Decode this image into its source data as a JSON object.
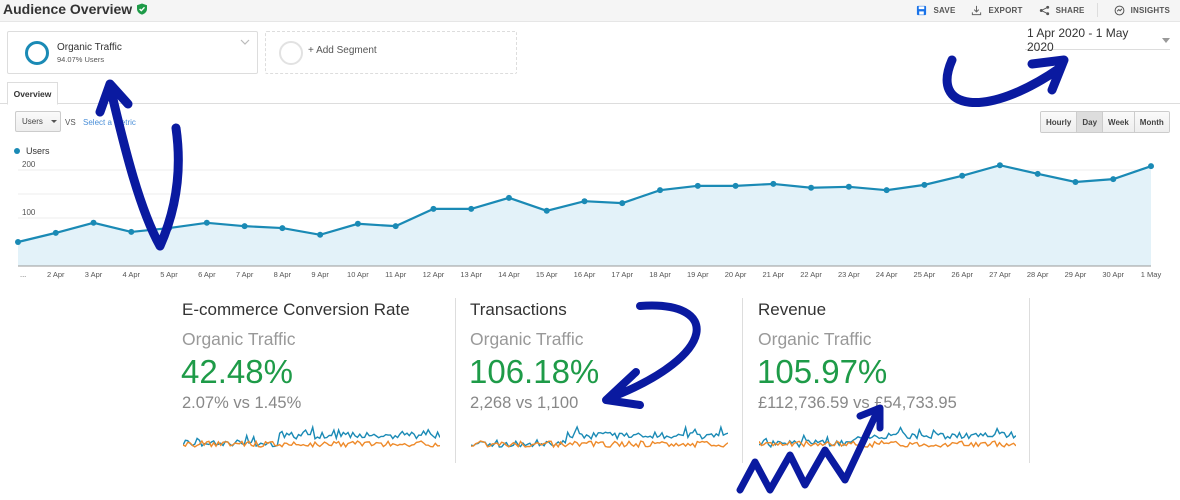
{
  "header": {
    "title": "Audience Overview",
    "actions": [
      {
        "label": "SAVE",
        "icon": "save-icon"
      },
      {
        "label": "EXPORT",
        "icon": "export-icon"
      },
      {
        "label": "SHARE",
        "icon": "share-icon"
      },
      {
        "label": "INSIGHTS",
        "icon": "insights-icon"
      }
    ]
  },
  "segments": {
    "active": {
      "name": "Organic Traffic",
      "detail": "94.07% Users"
    },
    "add_label": "+ Add Segment"
  },
  "date_range": "1 Apr 2020 - 1 May 2020",
  "tabs": [
    {
      "label": "Overview"
    }
  ],
  "controls": {
    "metric": "Users",
    "vs_label": "VS",
    "compare_link": "Select a metric",
    "granularity": [
      {
        "label": "Hourly",
        "active": false
      },
      {
        "label": "Day",
        "active": true
      },
      {
        "label": "Week",
        "active": false
      },
      {
        "label": "Month",
        "active": false
      }
    ]
  },
  "chart_data": {
    "type": "area",
    "title": "",
    "legend": [
      "Users"
    ],
    "legend_position": "top-left",
    "series_color": "#1a8ab5",
    "fill_color": "#e3f2f9",
    "xlabel": "",
    "ylabel": "",
    "ylim": [
      0,
      220
    ],
    "yticks": [
      100,
      200
    ],
    "grid": true,
    "x": [
      "...",
      "2 Apr",
      "3 Apr",
      "4 Apr",
      "5 Apr",
      "6 Apr",
      "7 Apr",
      "8 Apr",
      "9 Apr",
      "10 Apr",
      "11 Apr",
      "12 Apr",
      "13 Apr",
      "14 Apr",
      "15 Apr",
      "16 Apr",
      "17 Apr",
      "18 Apr",
      "19 Apr",
      "20 Apr",
      "21 Apr",
      "22 Apr",
      "23 Apr",
      "24 Apr",
      "25 Apr",
      "26 Apr",
      "27 Apr",
      "28 Apr",
      "29 Apr",
      "30 Apr",
      "1 May"
    ],
    "series": [
      {
        "name": "Users",
        "values": [
          50,
          69,
          90,
          71,
          79,
          90,
          83,
          79,
          65,
          88,
          83,
          119,
          119,
          142,
          115,
          135,
          131,
          158,
          167,
          167,
          171,
          163,
          165,
          158,
          169,
          188,
          210,
          192,
          175,
          181,
          208
        ]
      }
    ]
  },
  "scorecards": [
    {
      "title": "E-commerce Conversion Rate",
      "segment": "Organic Traffic",
      "change": "42.48%",
      "comparison": "2.07% vs 1.45%"
    },
    {
      "title": "Transactions",
      "segment": "Organic Traffic",
      "change": "106.18%",
      "comparison": "2,268 vs 1,100"
    },
    {
      "title": "Revenue",
      "segment": "Organic Traffic",
      "change": "105.97%",
      "comparison": "£112,736.59 vs £54,733.95"
    }
  ],
  "sparkline_colors": {
    "current": "#1a8ab5",
    "previous": "#ee8a2a"
  },
  "annotation_color": "#0a1aa0"
}
